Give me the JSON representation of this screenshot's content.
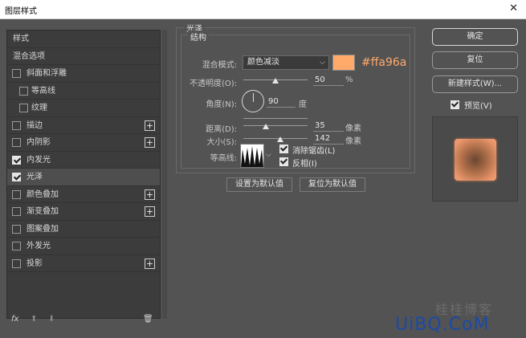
{
  "window": {
    "title": "图层样式",
    "close_glyph": "✕"
  },
  "styles_list": {
    "items": [
      {
        "label": "样式",
        "has_checkbox": false,
        "checked": false,
        "has_plus": false
      },
      {
        "label": "混合选项",
        "has_checkbox": false,
        "checked": false,
        "has_plus": false
      },
      {
        "label": "斜面和浮雕",
        "has_checkbox": true,
        "checked": false,
        "has_plus": false
      },
      {
        "label": "等高线",
        "has_checkbox": true,
        "checked": false,
        "has_plus": false,
        "sub": true
      },
      {
        "label": "纹理",
        "has_checkbox": true,
        "checked": false,
        "has_plus": false,
        "sub": true
      },
      {
        "label": "描边",
        "has_checkbox": true,
        "checked": false,
        "has_plus": true
      },
      {
        "label": "内阴影",
        "has_checkbox": true,
        "checked": false,
        "has_plus": true
      },
      {
        "label": "内发光",
        "has_checkbox": true,
        "checked": true,
        "has_plus": false
      },
      {
        "label": "光泽",
        "has_checkbox": true,
        "checked": true,
        "has_plus": false,
        "selected": true
      },
      {
        "label": "颜色叠加",
        "has_checkbox": true,
        "checked": false,
        "has_plus": true
      },
      {
        "label": "渐变叠加",
        "has_checkbox": true,
        "checked": false,
        "has_plus": true
      },
      {
        "label": "图案叠加",
        "has_checkbox": true,
        "checked": false,
        "has_plus": false
      },
      {
        "label": "外发光",
        "has_checkbox": true,
        "checked": false,
        "has_plus": false
      },
      {
        "label": "投影",
        "has_checkbox": true,
        "checked": false,
        "has_plus": true
      }
    ],
    "plus_glyph": "+",
    "tools": {
      "fx": "fx",
      "up": "⬆",
      "down": "⬇",
      "trash": "🗑"
    }
  },
  "satin": {
    "group_title": "光泽",
    "section_title": "结构",
    "blend_mode_label": "混合模式:",
    "blend_mode_value": "颜色减淡",
    "color_hex": "#ffa96a",
    "opacity_label": "不透明度(O):",
    "opacity_value": "50",
    "opacity_unit": "%",
    "angle_label": "角度(N):",
    "angle_value": "90",
    "angle_unit": "度",
    "distance_label": "距离(D):",
    "distance_value": "35",
    "distance_unit": "像素",
    "size_label": "大小(S):",
    "size_value": "142",
    "size_unit": "像素",
    "contour_label": "等高线:",
    "antialias_label": "消除锯齿(L)",
    "antialias_checked": true,
    "invert_label": "反相(I)",
    "invert_checked": true,
    "set_default_label": "设置为默认值",
    "reset_default_label": "复位为默认值",
    "opacity_fraction": 0.5,
    "distance_fraction": 0.35,
    "size_fraction": 0.57
  },
  "right_panel": {
    "ok_label": "确定",
    "reset_label": "复位",
    "new_style_label": "新建样式(W)...",
    "preview_label": "预览(V)",
    "preview_checked": true
  },
  "watermark": {
    "latin": "UiBQ.CoM",
    "cn": "桂桂博客"
  },
  "colors": {
    "accent": "#ffa96a",
    "panel": "#535353",
    "list": "#3c3c3c"
  }
}
